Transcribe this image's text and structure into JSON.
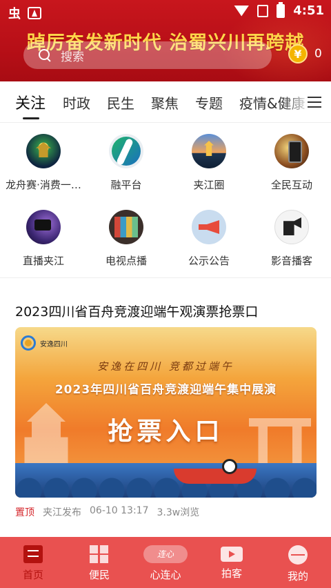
{
  "status_bar": {
    "time": "4:51",
    "app_glyph": "虫"
  },
  "header": {
    "slogan": "踔厉奋发新时代  治蜀兴川再跨越",
    "search_placeholder": "搜索",
    "coin_symbol": "¥",
    "coin_count": "0",
    "accent": "#c8161d"
  },
  "tabs": [
    {
      "label": "关注",
      "active": true
    },
    {
      "label": "时政"
    },
    {
      "label": "民生"
    },
    {
      "label": "聚焦"
    },
    {
      "label": "专题"
    },
    {
      "label": "疫情&健康"
    }
  ],
  "entries": [
    {
      "label": "龙舟赛·消费一…",
      "icon": "dragon-boat-tower-icon"
    },
    {
      "label": "融平台",
      "icon": "rong-platform-icon"
    },
    {
      "label": "夹江圈",
      "icon": "jiajiang-circle-icon"
    },
    {
      "label": "全民互动",
      "icon": "phone-interaction-icon"
    },
    {
      "label": "直播夹江",
      "icon": "live-camera-icon"
    },
    {
      "label": "电视点播",
      "icon": "tv-wall-icon"
    },
    {
      "label": "公示公告",
      "icon": "megaphone-icon"
    },
    {
      "label": "影音播客",
      "icon": "clapperboard-icon"
    }
  ],
  "article": {
    "title": "2023四川省百舟竞渡迎端午观演票抢票口",
    "banner": {
      "logo_text": "安逸四川",
      "tagline": "安逸在四川  竞都过端午",
      "subtitle": "2023年四川省百舟竞渡迎端午集中展演",
      "main": "抢票入口"
    },
    "meta": {
      "pin": "置顶",
      "source": "夹江发布",
      "datetime": "06-10 13:17",
      "views": "3.3w浏览"
    }
  },
  "bottom_nav": {
    "bg": "#e95150",
    "items": [
      {
        "label": "首页",
        "active": true
      },
      {
        "label": "便民"
      },
      {
        "label": "心连心",
        "logo_text": "连心"
      },
      {
        "label": "拍客"
      },
      {
        "label": "我的"
      }
    ]
  }
}
